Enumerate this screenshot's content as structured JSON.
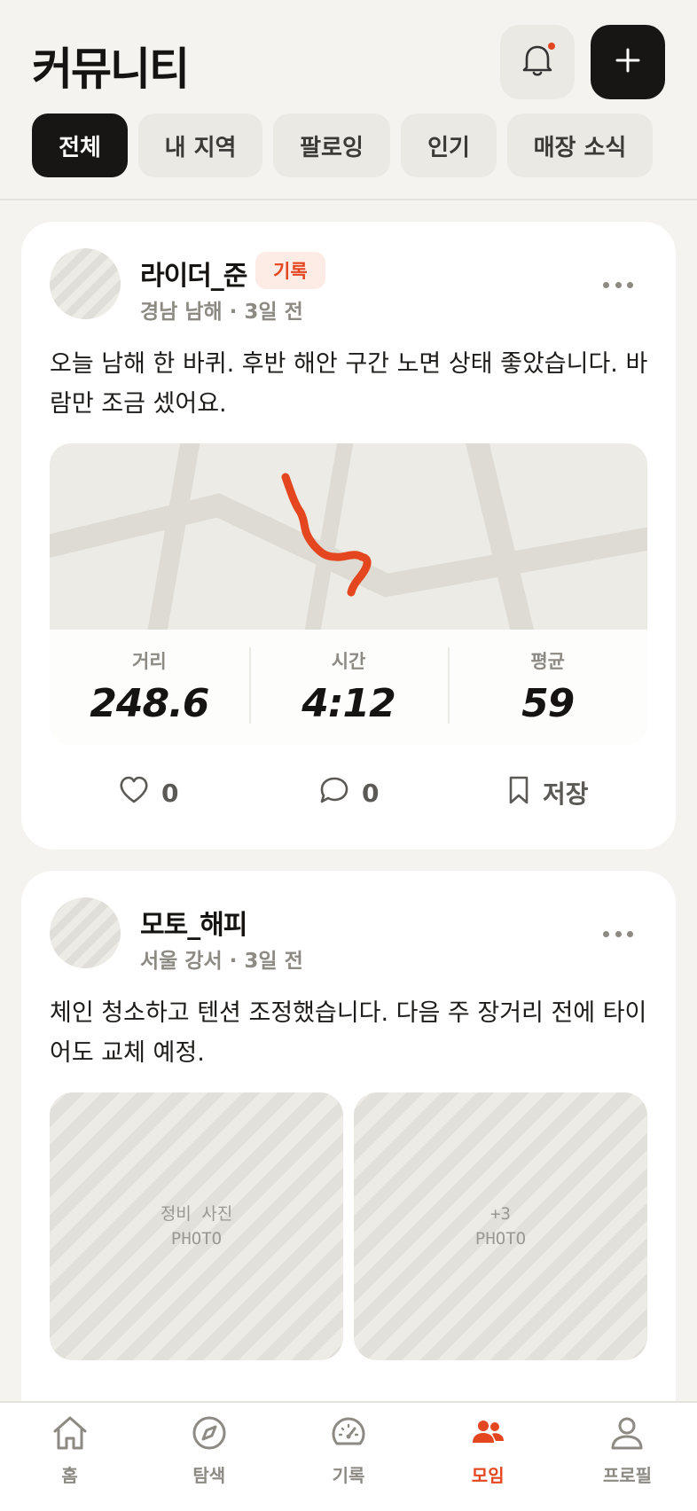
{
  "header": {
    "title": "커뮤니티",
    "tabs": [
      {
        "label": "전체",
        "active": true
      },
      {
        "label": "내 지역",
        "active": false
      },
      {
        "label": "팔로잉",
        "active": false
      },
      {
        "label": "인기",
        "active": false
      },
      {
        "label": "매장 소식",
        "active": false
      }
    ]
  },
  "posts": [
    {
      "username": "라이더_준",
      "badge": "기록",
      "meta": "경남 남해 · 3일 전",
      "text": "오늘 남해 한 바퀴. 후반 해안 구간 노면 상태 좋았습니다. 바람만 조금 셌어요.",
      "stats": [
        {
          "label": "거리",
          "value": "248.6"
        },
        {
          "label": "시간",
          "value": "4:12"
        },
        {
          "label": "평균",
          "value": "59"
        }
      ],
      "likes": "0",
      "comments": "0",
      "save_label": "저장"
    },
    {
      "username": "모토_해피",
      "meta": "서울 강서 · 3일 전",
      "text": "체인 청소하고 텐션 조정했습니다. 다음 주 장거리 전에 타이어도 교체 예정.",
      "photos": [
        {
          "caption": "정비 사진",
          "tag": "PHOTO"
        },
        {
          "caption": "+3",
          "tag": "PHOTO"
        }
      ]
    }
  ],
  "nav": [
    {
      "label": "홈",
      "icon": "home-icon",
      "active": false
    },
    {
      "label": "탐색",
      "icon": "compass-icon",
      "active": false
    },
    {
      "label": "기록",
      "icon": "speedometer-icon",
      "active": false
    },
    {
      "label": "모임",
      "icon": "group-icon",
      "active": true
    },
    {
      "label": "프로필",
      "icon": "person-icon",
      "active": false
    }
  ],
  "colors": {
    "accent": "#e4461f",
    "dark": "#171614",
    "background": "#f4f3f0"
  }
}
